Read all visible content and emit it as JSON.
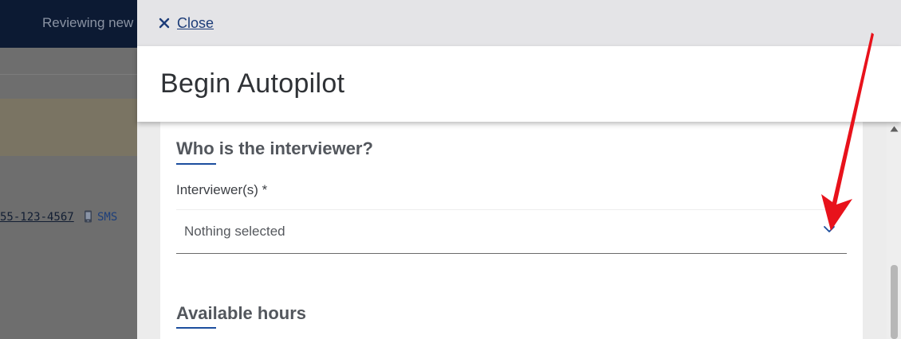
{
  "background_page": {
    "header_title": "Reviewing new",
    "phone_number": "55-123-4567",
    "sms_icon": "phone-icon",
    "sms_label": "SMS"
  },
  "panel": {
    "close_label": "Close",
    "close_icon": "close-icon",
    "title": "Begin Autopilot",
    "sections": [
      {
        "heading": "Who is the interviewer?",
        "field_label": "Interviewer(s) *",
        "field_value": "Nothing selected",
        "dropdown_icon": "chevron-down-icon"
      },
      {
        "heading": "Available hours"
      }
    ]
  },
  "annotation": {
    "type": "arrow",
    "color": "#e8121b",
    "points_to": "interviewer-dropdown-chevron"
  },
  "colors": {
    "accent": "#1c4e9e",
    "link": "#1c3c78",
    "topbar_dark": "#0c1a33"
  }
}
